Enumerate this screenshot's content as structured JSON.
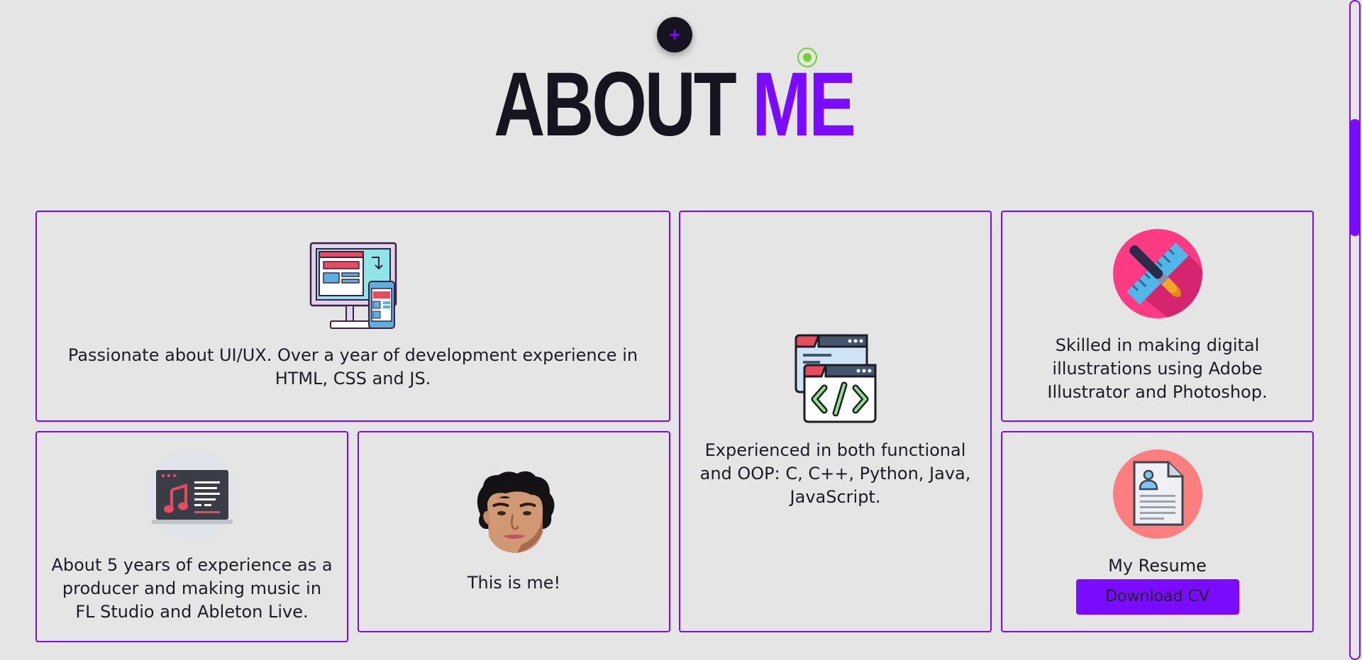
{
  "header": {
    "fab_symbol": "+",
    "title_part1": "ABOUT",
    "title_part2": "ME"
  },
  "cards": {
    "uiux": {
      "icon": "responsive-devices-icon",
      "text": "Passionate about UI/UX. Over a year of development experience in HTML, CSS and JS."
    },
    "programming": {
      "icon": "code-windows-icon",
      "text": "Experienced in both functional and OOP: C, C++, Python, Java, JavaScript."
    },
    "illustration": {
      "icon": "design-tools-icon",
      "text": "Skilled in making digital illustrations using Adobe Illustrator and Photoshop."
    },
    "music": {
      "icon": "music-laptop-icon",
      "text": "About 5 years of experience as a producer and making music in FL Studio and Ableton Live."
    },
    "me": {
      "icon": "avatar-face-icon",
      "text": "This is me!"
    },
    "resume": {
      "icon": "resume-document-icon",
      "text": "My Resume",
      "button_label": "Download CV"
    }
  },
  "colors": {
    "accent": "#7a0bff",
    "background": "#e6e5e6",
    "dark": "#15141f",
    "cursor": "#6bd428"
  }
}
